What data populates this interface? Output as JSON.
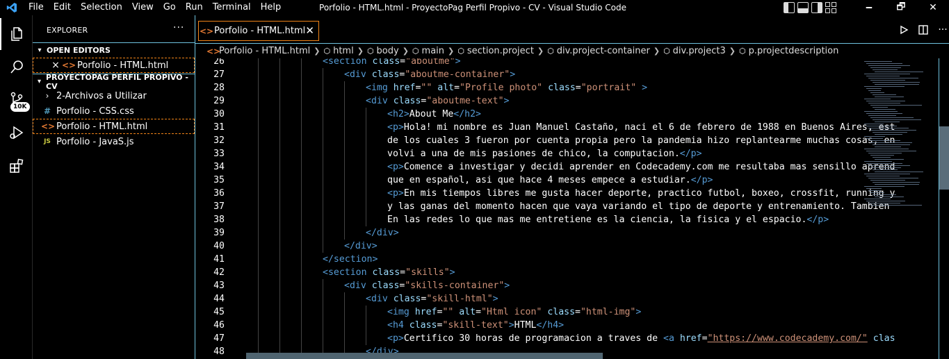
{
  "titlebar": {
    "menus": [
      "File",
      "Edit",
      "Selection",
      "View",
      "Go",
      "Run",
      "Terminal",
      "Help"
    ],
    "title": "Porfolio - HTML.html - ProyectoPag Perfil Propivo - CV - Visual Studio Code",
    "minimize": "🗕",
    "restore": "🗗",
    "close": "✕"
  },
  "activitybar": {
    "source_control_badge": "10K"
  },
  "sidebar": {
    "title": "EXPLORER",
    "more": "···",
    "open_editors": {
      "header": "OPEN EDITORS",
      "items": [
        {
          "close": "×",
          "name": "Porfolio - HTML.html"
        }
      ]
    },
    "project": {
      "header": "PROYECTOPAG PERFIL PROPIVO - CV",
      "items": [
        {
          "type": "folder",
          "icon": "›",
          "name": "2-Archivos a Utilizar"
        },
        {
          "type": "css",
          "icon": "#",
          "name": "Porfolio - CSS.css"
        },
        {
          "type": "html",
          "icon": "<>",
          "name": "Porfolio - HTML.html"
        },
        {
          "type": "js",
          "icon": "JS",
          "name": "Porfolio - JavaS.js"
        }
      ]
    }
  },
  "tabs": [
    {
      "label": "Porfolio - HTML.html",
      "close": "✕"
    }
  ],
  "breadcrumb": [
    {
      "icon": "html",
      "label": "Porfolio - HTML.html"
    },
    {
      "icon": "cube",
      "label": "html"
    },
    {
      "icon": "cube",
      "label": "body"
    },
    {
      "icon": "cube",
      "label": "main"
    },
    {
      "icon": "cube",
      "label": "section.project"
    },
    {
      "icon": "cube",
      "label": "div.project-container"
    },
    {
      "icon": "cube",
      "label": "div.project3"
    },
    {
      "icon": "cube",
      "label": "p.projectdescription"
    }
  ],
  "editor": {
    "lines": [
      {
        "n": "26",
        "indent": 3,
        "tokens": [
          [
            "tag",
            "<section "
          ],
          [
            "attr",
            "class"
          ],
          [
            "txt",
            "="
          ],
          [
            "val",
            "\"aboutme\""
          ],
          [
            "tag",
            ">"
          ]
        ]
      },
      {
        "n": "27",
        "indent": 4,
        "tokens": [
          [
            "tag",
            "<div "
          ],
          [
            "attr",
            "class"
          ],
          [
            "txt",
            "="
          ],
          [
            "val",
            "\"aboutme-container\""
          ],
          [
            "tag",
            ">"
          ]
        ]
      },
      {
        "n": "28",
        "indent": 5,
        "tokens": [
          [
            "tag",
            "<img "
          ],
          [
            "attr",
            "href"
          ],
          [
            "txt",
            "="
          ],
          [
            "val",
            "\"\" "
          ],
          [
            "attr",
            "alt"
          ],
          [
            "txt",
            "="
          ],
          [
            "val",
            "\"Profile photo\" "
          ],
          [
            "attr",
            "class"
          ],
          [
            "txt",
            "="
          ],
          [
            "val",
            "\"portrait\" "
          ],
          [
            "tag",
            ">"
          ]
        ]
      },
      {
        "n": "29",
        "indent": 5,
        "tokens": [
          [
            "tag",
            "<div "
          ],
          [
            "attr",
            "class"
          ],
          [
            "txt",
            "="
          ],
          [
            "val",
            "\"aboutme-text\""
          ],
          [
            "tag",
            ">"
          ]
        ]
      },
      {
        "n": "30",
        "indent": 6,
        "tokens": [
          [
            "tag",
            "<h2>"
          ],
          [
            "txt",
            "About Me"
          ],
          [
            "tag",
            "</h2>"
          ]
        ]
      },
      {
        "n": "31",
        "indent": 6,
        "tokens": [
          [
            "tag",
            "<p>"
          ],
          [
            "txt",
            "Hola! mi nombre es Juan Manuel Castaño, naci el 6 de febrero de 1988 en Buenos Aires, est"
          ]
        ]
      },
      {
        "n": "32",
        "indent": 6,
        "tokens": [
          [
            "txt",
            "de los cuales 3 fueron por cuenta propia pero la pandemia hizo replantearme muchas cosas, en"
          ]
        ]
      },
      {
        "n": "33",
        "indent": 6,
        "tokens": [
          [
            "txt",
            "volvi a una de mis pasiones de chico, la computacion."
          ],
          [
            "tag",
            "</p>"
          ]
        ]
      },
      {
        "n": "34",
        "indent": 6,
        "tokens": [
          [
            "tag",
            "<p>"
          ],
          [
            "txt",
            "Comence a investigar y decidi aprender en Codecademy.com me resultaba mas sensillo aprend"
          ]
        ]
      },
      {
        "n": "35",
        "indent": 6,
        "tokens": [
          [
            "txt",
            "que en español, asi que hace 4 meses empece a estudiar."
          ],
          [
            "tag",
            "</p>"
          ]
        ]
      },
      {
        "n": "36",
        "indent": 6,
        "tokens": [
          [
            "tag",
            "<p>"
          ],
          [
            "txt",
            "En mis tiempos libres me gusta hacer deporte, practico futbol, boxeo, crossfit, running y"
          ]
        ]
      },
      {
        "n": "37",
        "indent": 6,
        "tokens": [
          [
            "txt",
            "y las ganas del momento hacen que vaya variando el tipo de deporte y entrenamiento. Tambien"
          ]
        ]
      },
      {
        "n": "38",
        "indent": 6,
        "tokens": [
          [
            "txt",
            "En las redes lo que mas me entretiene es la ciencia, la fisica y el espacio."
          ],
          [
            "tag",
            "</p>"
          ]
        ]
      },
      {
        "n": "39",
        "indent": 5,
        "tokens": [
          [
            "tag",
            "</div>"
          ]
        ]
      },
      {
        "n": "40",
        "indent": 4,
        "tokens": [
          [
            "tag",
            "</div>"
          ]
        ]
      },
      {
        "n": "41",
        "indent": 3,
        "tokens": [
          [
            "tag",
            "</section>"
          ]
        ]
      },
      {
        "n": "42",
        "indent": 3,
        "tokens": [
          [
            "tag",
            "<section "
          ],
          [
            "attr",
            "class"
          ],
          [
            "txt",
            "="
          ],
          [
            "val",
            "\"skills\""
          ],
          [
            "tag",
            ">"
          ]
        ]
      },
      {
        "n": "43",
        "indent": 4,
        "tokens": [
          [
            "tag",
            "<div "
          ],
          [
            "attr",
            "class"
          ],
          [
            "txt",
            "="
          ],
          [
            "val",
            "\"skills-container\""
          ],
          [
            "tag",
            ">"
          ]
        ]
      },
      {
        "n": "44",
        "indent": 5,
        "tokens": [
          [
            "tag",
            "<div "
          ],
          [
            "attr",
            "class"
          ],
          [
            "txt",
            "="
          ],
          [
            "val",
            "\"skill-html\""
          ],
          [
            "tag",
            ">"
          ]
        ]
      },
      {
        "n": "45",
        "indent": 6,
        "tokens": [
          [
            "tag",
            "<img "
          ],
          [
            "attr",
            "href"
          ],
          [
            "txt",
            "="
          ],
          [
            "val",
            "\"\" "
          ],
          [
            "attr",
            "alt"
          ],
          [
            "txt",
            "="
          ],
          [
            "val",
            "\"Html icon\" "
          ],
          [
            "attr",
            "class"
          ],
          [
            "txt",
            "="
          ],
          [
            "val",
            "\"html-img\""
          ],
          [
            "tag",
            ">"
          ]
        ]
      },
      {
        "n": "46",
        "indent": 6,
        "tokens": [
          [
            "tag",
            "<h4 "
          ],
          [
            "attr",
            "class"
          ],
          [
            "txt",
            "="
          ],
          [
            "val",
            "\"skill-text\""
          ],
          [
            "tag",
            ">"
          ],
          [
            "txt",
            "HTML"
          ],
          [
            "tag",
            "</h4>"
          ]
        ]
      },
      {
        "n": "47",
        "indent": 6,
        "tokens": [
          [
            "tag",
            "<p>"
          ],
          [
            "txt",
            "Certifico 30 horas de programacion a traves de "
          ],
          [
            "tag",
            "<a "
          ],
          [
            "attr",
            "href"
          ],
          [
            "txt",
            "="
          ],
          [
            "link",
            "\"https://www.codecademy.com/\""
          ],
          [
            "txt",
            " "
          ],
          [
            "attr",
            "clas"
          ]
        ]
      },
      {
        "n": "48",
        "indent": 5,
        "tokens": [
          [
            "tag",
            "</div>"
          ]
        ]
      }
    ]
  }
}
